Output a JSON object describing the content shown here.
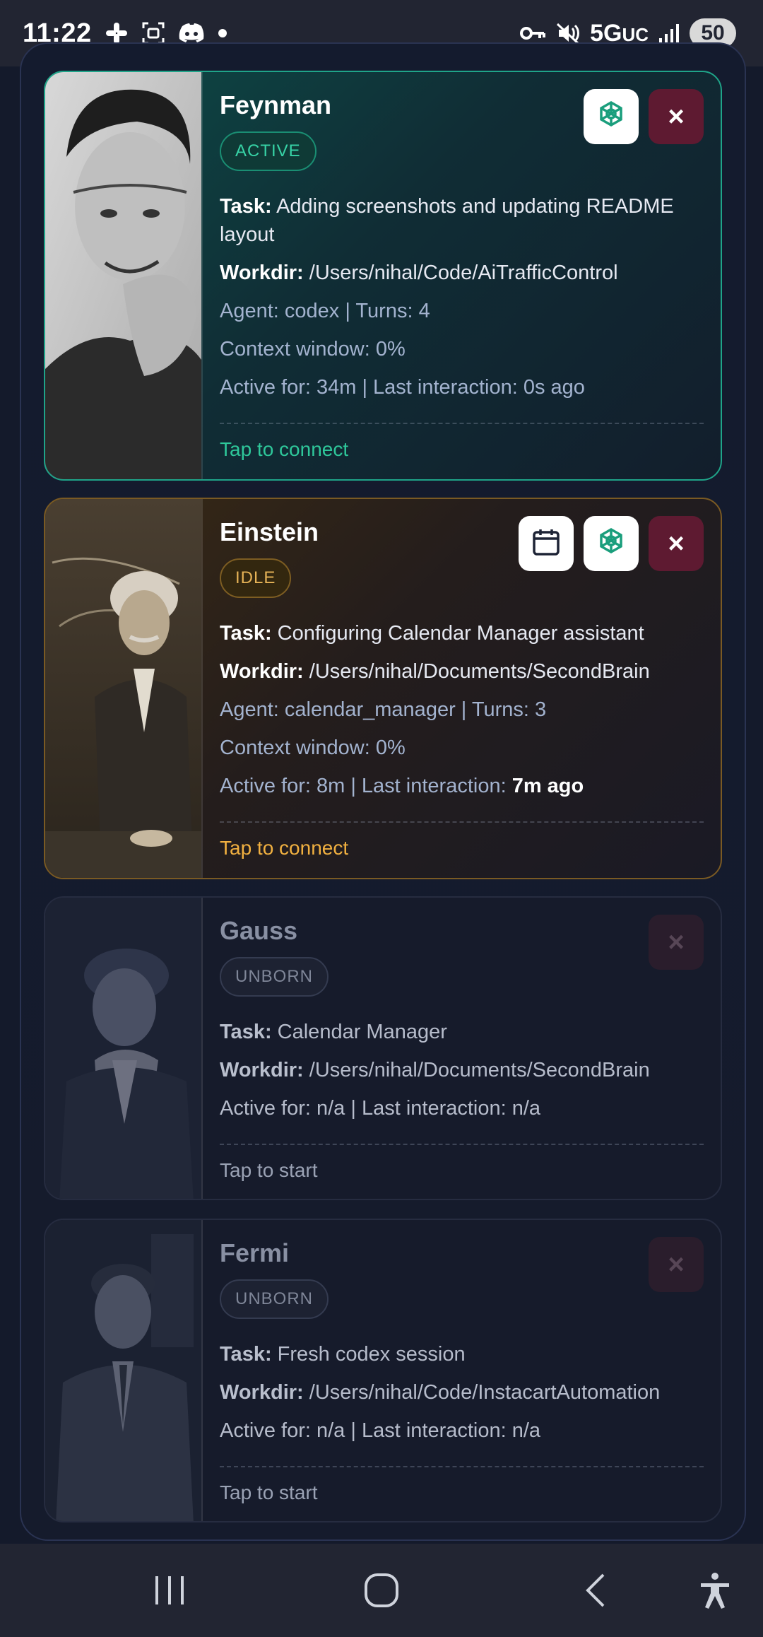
{
  "status_bar": {
    "time": "11:22",
    "network": "5G",
    "network_sub": "UC",
    "battery": "50"
  },
  "cards": [
    {
      "name": "Feynman",
      "status": "ACTIVE",
      "task_label": "Task:",
      "task": "Adding screenshots and updating README layout",
      "workdir_label": "Workdir:",
      "workdir": "/Users/nihal/Code/AiTrafficControl",
      "agent_line": "Agent: codex | Turns: 4",
      "context_line": "Context window: 0%",
      "active_line": "Active for: 34m | Last interaction: 0s ago",
      "action": "Tap to connect"
    },
    {
      "name": "Einstein",
      "status": "IDLE",
      "task_label": "Task:",
      "task": "Configuring Calendar Manager assistant",
      "workdir_label": "Workdir:",
      "workdir": "/Users/nihal/Documents/SecondBrain",
      "agent_line": "Agent: calendar_manager | Turns: 3",
      "context_line": "Context window: 0%",
      "active_prefix": "Active for: 8m | Last interaction: ",
      "active_strong": "7m ago",
      "action": "Tap to connect"
    },
    {
      "name": "Gauss",
      "status": "UNBORN",
      "task_label": "Task:",
      "task": "Calendar Manager",
      "workdir_label": "Workdir:",
      "workdir": "/Users/nihal/Documents/SecondBrain",
      "active_line": "Active for: n/a | Last interaction: n/a",
      "action": "Tap to start"
    },
    {
      "name": "Fermi",
      "status": "UNBORN",
      "task_label": "Task:",
      "task": "Fresh codex session",
      "workdir_label": "Workdir:",
      "workdir": "/Users/nihal/Code/InstacartAutomation",
      "active_line": "Active for: n/a | Last interaction: n/a",
      "action": "Tap to start"
    }
  ],
  "icons": {
    "close": "×",
    "openai": "openai-icon",
    "calendar": "calendar-icon"
  },
  "colors": {
    "active": "#2ec79a",
    "idle": "#f1b040",
    "close_button": "#5e1a31"
  }
}
